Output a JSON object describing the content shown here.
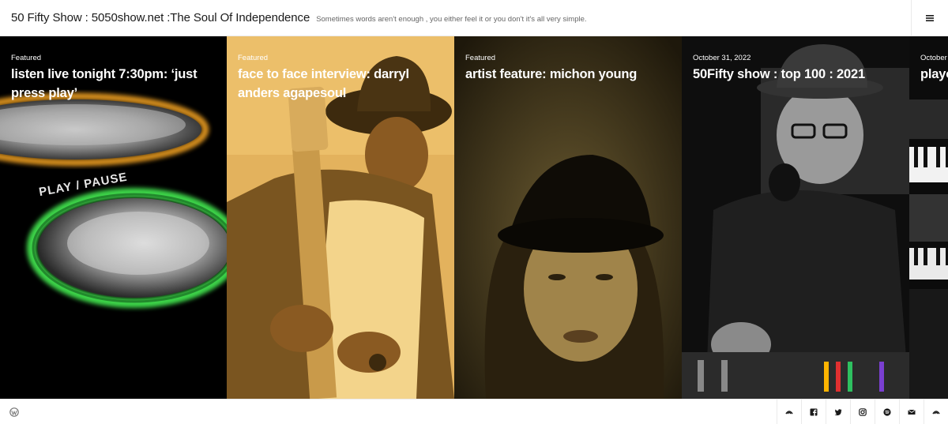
{
  "header": {
    "site_title": "50 Fifty Show : 5050show.net :The Soul Of Independence",
    "tagline": "Sometimes words aren't enough , you either feel it or you don't it's all very simple.",
    "menu_icon": "hamburger-menu-icon"
  },
  "featured": [
    {
      "meta": "Featured",
      "title": "listen live tonight 7:30pm: ‘just press play’",
      "image_desc_icon": "play-pause-button-artwork"
    },
    {
      "meta": "Featured",
      "title": "face to face interview: darryl anders agapesoul",
      "image_desc_icon": "bass-guitarist-photo"
    },
    {
      "meta": "Featured",
      "title": "artist feature: michon young",
      "image_desc_icon": "singer-portrait-photo"
    },
    {
      "meta": "October 31, 2022",
      "title": "50Fifty show : top 100 : 2021",
      "image_desc_icon": "dj-at-mixer-photo"
    },
    {
      "meta": "October",
      "title": "playo",
      "image_desc_icon": "keyboard-studio-photo"
    }
  ],
  "footer": {
    "wordpress_icon": "wordpress-icon",
    "social": [
      "mixcloud-icon",
      "facebook-icon",
      "twitter-icon",
      "instagram-icon",
      "spotify-icon",
      "email-icon",
      "mixcloud-icon"
    ]
  },
  "colors": {
    "tile1_bg": "#000000",
    "tile2_tint": "#e9b860",
    "tile3_tint": "#4a3e1e",
    "tile4_bg": "#111111",
    "accent_green": "#3cd64a",
    "accent_orange": "#f0a020"
  }
}
